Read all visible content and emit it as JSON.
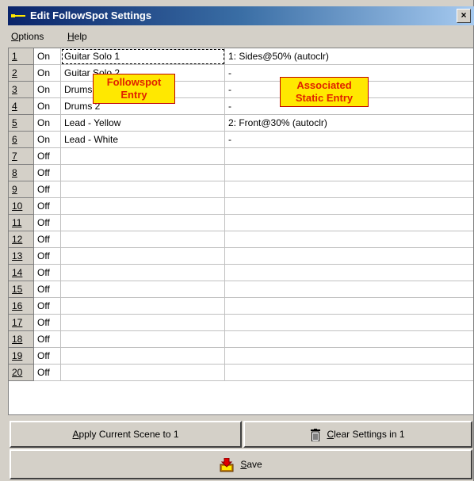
{
  "window": {
    "title": "Edit FollowSpot Settings",
    "close_glyph": "×"
  },
  "menu": [
    {
      "label_first": "O",
      "label_rest": "ptions"
    },
    {
      "label_first": "H",
      "label_rest": "elp"
    }
  ],
  "rows": [
    {
      "num": "1",
      "state": "On",
      "entry": "Guitar Solo 1",
      "static": "1: Sides@50% (autoclr)"
    },
    {
      "num": "2",
      "state": "On",
      "entry": "Guitar Solo 2",
      "static": "-"
    },
    {
      "num": "3",
      "state": "On",
      "entry": "Drums 1",
      "static": "-"
    },
    {
      "num": "4",
      "state": "On",
      "entry": "Drums 2",
      "static": "-"
    },
    {
      "num": "5",
      "state": "On",
      "entry": "Lead - Yellow",
      "static": "2: Front@30% (autoclr)"
    },
    {
      "num": "6",
      "state": "On",
      "entry": "Lead - White",
      "static": "-"
    },
    {
      "num": "7",
      "state": "Off",
      "entry": "",
      "static": ""
    },
    {
      "num": "8",
      "state": "Off",
      "entry": "",
      "static": ""
    },
    {
      "num": "9",
      "state": "Off",
      "entry": "",
      "static": ""
    },
    {
      "num": "10",
      "state": "Off",
      "entry": "",
      "static": ""
    },
    {
      "num": "11",
      "state": "Off",
      "entry": "",
      "static": ""
    },
    {
      "num": "12",
      "state": "Off",
      "entry": "",
      "static": ""
    },
    {
      "num": "13",
      "state": "Off",
      "entry": "",
      "static": ""
    },
    {
      "num": "14",
      "state": "Off",
      "entry": "",
      "static": ""
    },
    {
      "num": "15",
      "state": "Off",
      "entry": "",
      "static": ""
    },
    {
      "num": "16",
      "state": "Off",
      "entry": "",
      "static": ""
    },
    {
      "num": "17",
      "state": "Off",
      "entry": "",
      "static": ""
    },
    {
      "num": "18",
      "state": "Off",
      "entry": "",
      "static": ""
    },
    {
      "num": "19",
      "state": "Off",
      "entry": "",
      "static": ""
    },
    {
      "num": "20",
      "state": "Off",
      "entry": "",
      "static": ""
    }
  ],
  "callouts": {
    "followspot": {
      "line1": "Followspot",
      "line2": "Entry"
    },
    "static": {
      "line1": "Associated",
      "line2": "Static Entry"
    }
  },
  "buttons": {
    "apply": {
      "label_first": "A",
      "label_rest": "pply Current Scene to 1"
    },
    "clear": {
      "label_first": "C",
      "label_rest": "lear Settings in 1",
      "icon": "trash-icon"
    },
    "save": {
      "label_first": "S",
      "label_rest": "ave",
      "icon": "save-icon"
    }
  },
  "colors": {
    "title_start": "#0a246a",
    "callout_bg": "#ffe800",
    "callout_text": "#e02000"
  }
}
